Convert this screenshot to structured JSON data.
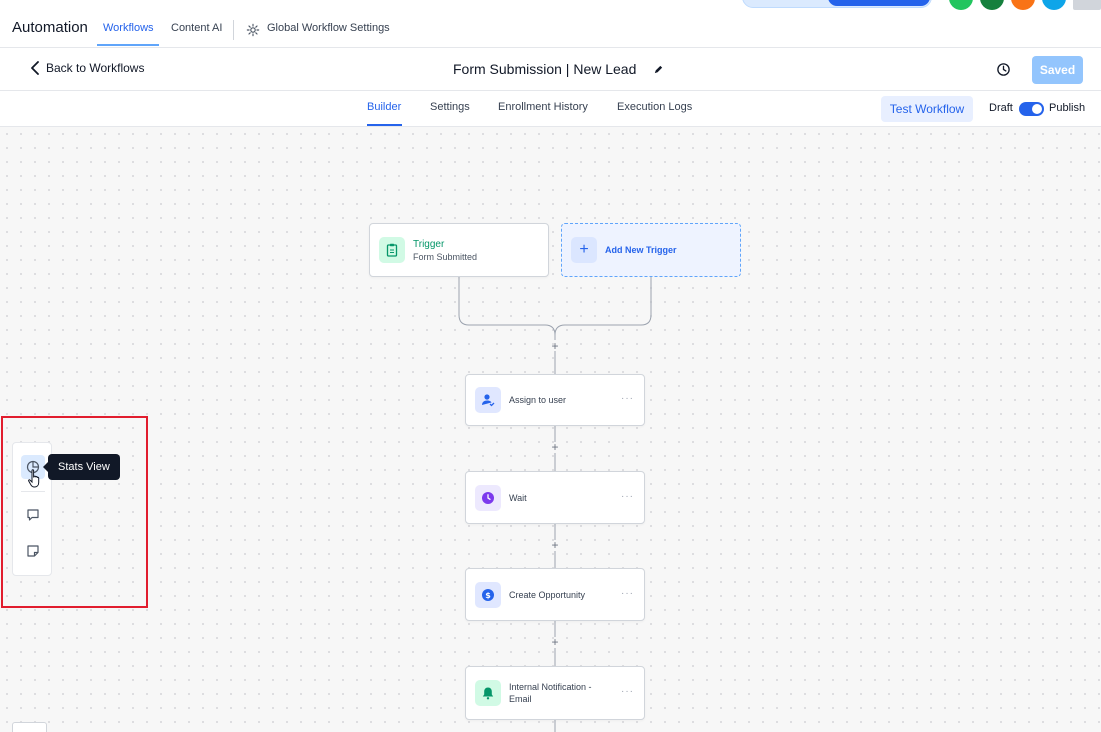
{
  "topnav": {
    "app_title": "Automation",
    "tabs": [
      {
        "label": "Workflows",
        "active": true
      },
      {
        "label": "Content AI",
        "active": false
      }
    ],
    "settings_label": "Global Workflow Settings",
    "avatar_colors": [
      "#22c55e",
      "#15803d",
      "#f97316",
      "#0ea5e9"
    ]
  },
  "header": {
    "back_label": "Back to Workflows",
    "title": "Form Submission | New Lead",
    "saved_label": "Saved"
  },
  "subtabs": {
    "items": [
      {
        "label": "Builder",
        "active": true
      },
      {
        "label": "Settings",
        "active": false
      },
      {
        "label": "Enrollment History",
        "active": false
      },
      {
        "label": "Execution Logs",
        "active": false
      }
    ],
    "test_label": "Test Workflow",
    "draft_label": "Draft",
    "publish_label": "Publish",
    "published": true
  },
  "canvas": {
    "trigger": {
      "title": "Trigger",
      "subtitle": "Form Submitted"
    },
    "add_trigger_label": "Add New Trigger",
    "actions": [
      {
        "label": "Assign to user",
        "icon": "user-assign-icon",
        "color": "#2563eb"
      },
      {
        "label": "Wait",
        "icon": "clock-icon",
        "color": "#7c3aed"
      },
      {
        "label": "Create Opportunity",
        "icon": "dollar-icon",
        "color": "#2563eb"
      },
      {
        "label": "Internal Notification - Email",
        "icon": "bell-icon",
        "color": "#059669"
      }
    ],
    "add_step_glyph": "+",
    "more_glyph": "···"
  },
  "side_toolbar": {
    "tooltip": "Stats View",
    "tools": [
      "stats-view-icon",
      "comment-icon",
      "sticky-note-icon"
    ]
  },
  "colors": {
    "accent": "#2563eb",
    "highlight": "#e11d2e"
  }
}
